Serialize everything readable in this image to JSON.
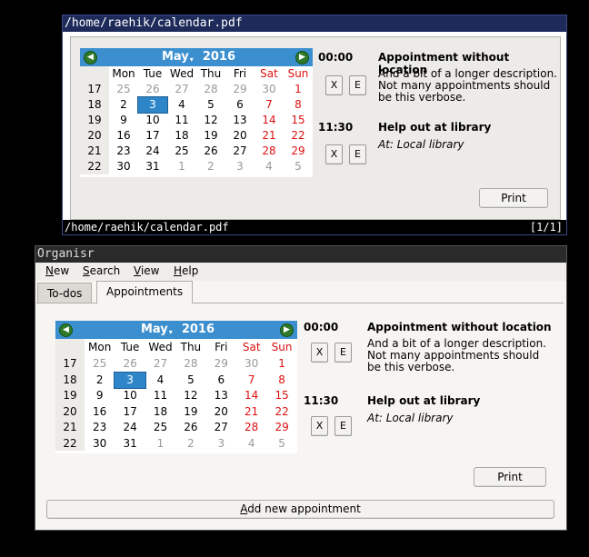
{
  "pdf": {
    "title": "/home/raehik/calendar.pdf",
    "status_path": "/home/raehik/calendar.pdf",
    "page_indicator": "[1/1]"
  },
  "organisr": {
    "title": "Organisr",
    "menu": [
      "New",
      "Search",
      "View",
      "Help"
    ],
    "tabs": [
      "To-dos",
      "Appointments"
    ],
    "active_tab": "Appointments",
    "add_button": "Add new appointment",
    "print_button": "Print"
  },
  "calendar": {
    "month": "May",
    "year": "2016",
    "day_headers": [
      "Mon",
      "Tue",
      "Wed",
      "Thu",
      "Fri",
      "Sat",
      "Sun"
    ],
    "weeks": [
      {
        "week": "17",
        "days": [
          "25",
          "26",
          "27",
          "28",
          "29",
          "30",
          "1"
        ]
      },
      {
        "week": "18",
        "days": [
          "2",
          "3",
          "4",
          "5",
          "6",
          "7",
          "8"
        ]
      },
      {
        "week": "19",
        "days": [
          "9",
          "10",
          "11",
          "12",
          "13",
          "14",
          "15"
        ]
      },
      {
        "week": "20",
        "days": [
          "16",
          "17",
          "18",
          "19",
          "20",
          "21",
          "22"
        ]
      },
      {
        "week": "21",
        "days": [
          "23",
          "24",
          "25",
          "26",
          "27",
          "28",
          "29"
        ]
      },
      {
        "week": "22",
        "days": [
          "30",
          "31",
          "1",
          "2",
          "3",
          "4",
          "5"
        ]
      }
    ],
    "selected_day": "3"
  },
  "appointments": [
    {
      "time": "00:00",
      "title": "Appointment without location",
      "description": "And a bit of a longer description. Not many appointments should be this verbose.",
      "location": ""
    },
    {
      "time": "11:30",
      "title": "Help out at library",
      "description": "",
      "location": "At: Local library"
    }
  ],
  "buttons": {
    "delete": "X",
    "edit": "E",
    "print": "Print"
  }
}
